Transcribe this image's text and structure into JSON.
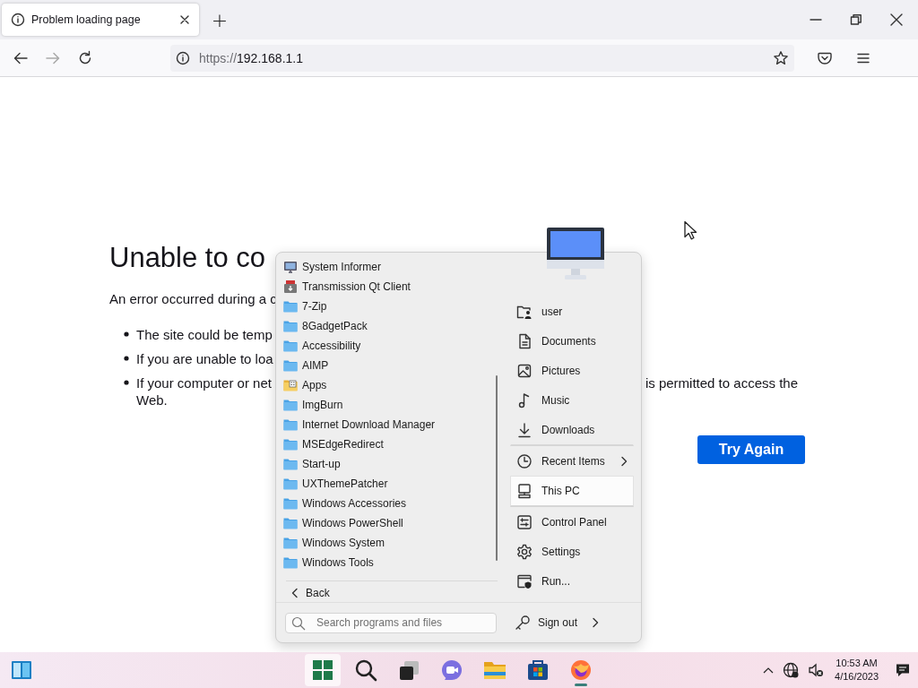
{
  "browser": {
    "tabs": [
      {
        "title": "Problem loading page",
        "selected": true
      }
    ],
    "new_tab": "+",
    "url": {
      "scheme": "https://",
      "host": "192.168.1.1"
    }
  },
  "page": {
    "heading": "Unable to co",
    "intro": "An error occurred during a c",
    "bullets": [
      {
        "parts": [
          "The site could be temp"
        ]
      },
      {
        "parts": [
          "If you are unable to loa"
        ]
      },
      {
        "parts": [
          "If your computer or net",
          "is permitted to access the"
        ],
        "continuation": "Web."
      }
    ],
    "button": "Try Again"
  },
  "start_menu": {
    "programs": [
      {
        "label": "System Informer",
        "kind": "monitor-app"
      },
      {
        "label": "Transmission Qt Client",
        "kind": "transmission-app"
      },
      {
        "label": "7-Zip",
        "kind": "folder"
      },
      {
        "label": "8GadgetPack",
        "kind": "folder"
      },
      {
        "label": "Accessibility",
        "kind": "folder"
      },
      {
        "label": "AIMP",
        "kind": "folder"
      },
      {
        "label": "Apps",
        "kind": "apps-folder"
      },
      {
        "label": "ImgBurn",
        "kind": "folder"
      },
      {
        "label": "Internet Download Manager",
        "kind": "folder"
      },
      {
        "label": "MSEdgeRedirect",
        "kind": "folder"
      },
      {
        "label": "Start-up",
        "kind": "folder"
      },
      {
        "label": "UXThemePatcher",
        "kind": "folder"
      },
      {
        "label": "Windows Accessories",
        "kind": "folder"
      },
      {
        "label": "Windows PowerShell",
        "kind": "folder"
      },
      {
        "label": "Windows System",
        "kind": "folder"
      },
      {
        "label": "Windows Tools",
        "kind": "folder"
      }
    ],
    "back": "Back",
    "places": [
      {
        "label": "user",
        "kind": "user",
        "selected": false,
        "submenu": false,
        "separator_after": false
      },
      {
        "label": "Documents",
        "kind": "document",
        "selected": false,
        "submenu": false,
        "separator_after": false
      },
      {
        "label": "Pictures",
        "kind": "picture",
        "selected": false,
        "submenu": false,
        "separator_after": false
      },
      {
        "label": "Music",
        "kind": "music",
        "selected": false,
        "submenu": false,
        "separator_after": false
      },
      {
        "label": "Downloads",
        "kind": "download",
        "selected": false,
        "submenu": false,
        "separator_after": true
      },
      {
        "label": "Recent Items",
        "kind": "clock",
        "selected": false,
        "submenu": true,
        "separator_after": false
      },
      {
        "label": "This PC",
        "kind": "pc",
        "selected": true,
        "submenu": false,
        "separator_after": true
      },
      {
        "label": "Control Panel",
        "kind": "control-panel",
        "selected": false,
        "submenu": false,
        "separator_after": false
      },
      {
        "label": "Settings",
        "kind": "settings",
        "selected": false,
        "submenu": false,
        "separator_after": false
      },
      {
        "label": "Run...",
        "kind": "run",
        "selected": false,
        "submenu": false,
        "separator_after": false
      }
    ],
    "search": {
      "placeholder": "Search programs and files"
    },
    "sign_out": "Sign out"
  },
  "taskbar": {
    "apps": [
      {
        "kind": "start",
        "highlighted": true,
        "running": false
      },
      {
        "kind": "search",
        "highlighted": false,
        "running": false
      },
      {
        "kind": "task-view",
        "highlighted": false,
        "running": false
      },
      {
        "kind": "chat",
        "highlighted": false,
        "running": false
      },
      {
        "kind": "explorer",
        "highlighted": false,
        "running": false
      },
      {
        "kind": "store",
        "highlighted": false,
        "running": false
      },
      {
        "kind": "firefox",
        "highlighted": false,
        "running": true
      }
    ],
    "time": "10:53 AM",
    "date": "4/16/2023"
  }
}
